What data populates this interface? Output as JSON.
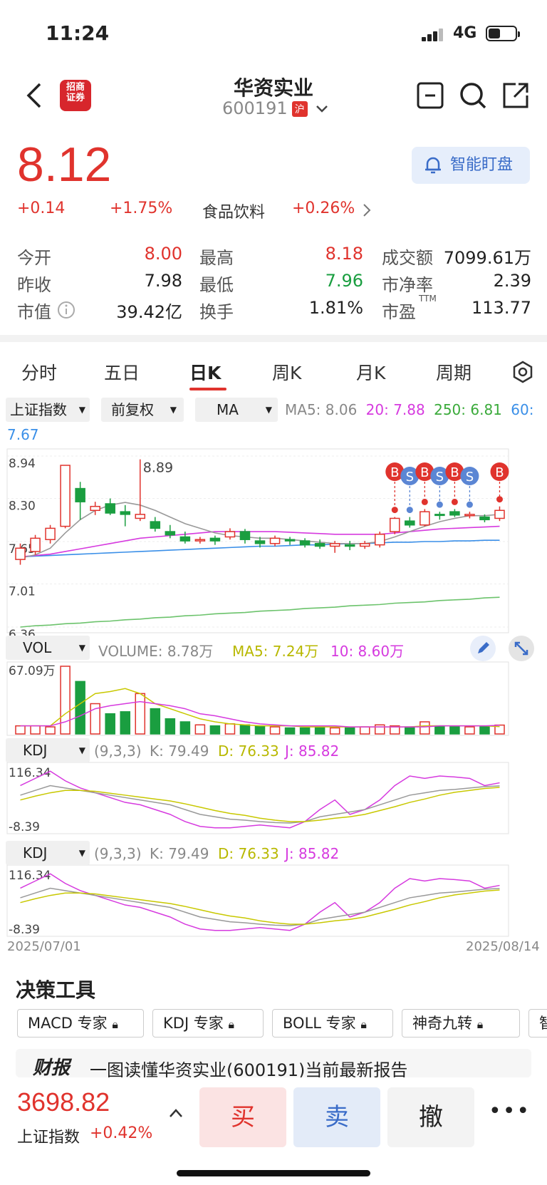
{
  "status_bar": {
    "time": "11:24",
    "network": "4G"
  },
  "header": {
    "back_icon": "chevron-left-icon",
    "broker_logo_text": "招商证券",
    "broker_logo_sub": "CMS",
    "stock_name": "华资实业",
    "stock_code": "600191",
    "market_badge": "沪",
    "icons": [
      "minus-square-icon",
      "search-icon",
      "share-icon"
    ]
  },
  "quote": {
    "price": "8.12",
    "change": "+0.14",
    "change_pct": "+1.75%",
    "sector_name": "食品饮料",
    "sector_change": "+0.26%",
    "alert_button": "智能盯盘",
    "price_color": "#e0332d"
  },
  "stats": {
    "row1": {
      "l1": "今开",
      "v1": "8.00",
      "l2": "最高",
      "v2": "8.18",
      "l3": "成交额",
      "v3": "7099.61万"
    },
    "row2": {
      "l1": "昨收",
      "v1": "7.98",
      "l2": "最低",
      "v2": "7.96",
      "l3": "市净率",
      "v3": "2.39"
    },
    "row3": {
      "l1": "市值",
      "v1": "39.42亿",
      "l2": "换手",
      "v2": "1.81%",
      "l3": "市盈",
      "l3_sup": "TTM",
      "v3": "113.77"
    }
  },
  "tabs": [
    "分时",
    "五日",
    "日K",
    "周K",
    "月K",
    "周期"
  ],
  "active_tab": "日K",
  "selectors": {
    "index": "上证指数",
    "adjust": "前复权",
    "indicator": "MA"
  },
  "ma_legend": {
    "ma5": "MA5: 8.06",
    "ma20": "20: 7.88",
    "ma250": "250: 6.81",
    "ma60": "60:",
    "ma60_val": "7.67"
  },
  "price_axis": [
    "8.94",
    "8.30",
    "7.65",
    "7.01",
    "6.36"
  ],
  "high_label": "8.89",
  "markers": [
    "B",
    "S",
    "B",
    "S",
    "B",
    "S",
    "B"
  ],
  "volume": {
    "selector": "VOL",
    "legend": "VOLUME: 8.78万",
    "ma5": "MA5: 7.24万",
    "ma10": "10: 8.60万",
    "axis_max": "67.09万"
  },
  "kdj1": {
    "selector": "KDJ",
    "params": "(9,3,3)",
    "k": "K: 79.49",
    "d": "D: 76.33",
    "j": "J: 85.82",
    "max": "116.34",
    "min": "-8.39"
  },
  "kdj2": {
    "selector": "KDJ",
    "params": "(9,3,3)",
    "k": "K: 79.49",
    "d": "D: 76.33",
    "j": "J: 85.82",
    "max": "116.34",
    "min": "-8.39"
  },
  "dates": {
    "start": "2025/07/01",
    "end": "2025/08/14"
  },
  "tools": {
    "title": "决策工具",
    "chips": [
      "MACD 专家",
      "KDJ 专家",
      "BOLL 专家",
      "神奇九转",
      "智"
    ],
    "report_tag": "财报",
    "report_text": "一图读懂华资实业(600191)当前最新报告"
  },
  "bottom": {
    "index_price": "3698.82",
    "index_name": "上证指数",
    "index_change": "+0.42%",
    "buy": "买",
    "sell": "卖",
    "cancel": "撤",
    "more": "•••"
  },
  "chart_data": {
    "type": "candlestick",
    "title": "",
    "x_start": "2025/07/01",
    "x_end": "2025/08/14",
    "ylim": [
      6.36,
      8.94
    ],
    "candles": [
      {
        "o": 7.38,
        "c": 7.55,
        "h": 7.62,
        "l": 7.3
      },
      {
        "o": 7.5,
        "c": 7.7,
        "h": 7.75,
        "l": 7.45
      },
      {
        "o": 7.68,
        "c": 7.85,
        "h": 7.9,
        "l": 7.62
      },
      {
        "o": 7.88,
        "c": 8.8,
        "h": 8.8,
        "l": 7.85
      },
      {
        "o": 8.45,
        "c": 8.25,
        "h": 8.55,
        "l": 7.98
      },
      {
        "o": 8.12,
        "c": 8.18,
        "h": 8.25,
        "l": 8.05
      },
      {
        "o": 8.22,
        "c": 8.08,
        "h": 8.3,
        "l": 8.05
      },
      {
        "o": 8.1,
        "c": 8.06,
        "h": 8.2,
        "l": 7.88
      },
      {
        "o": 8.0,
        "c": 8.06,
        "h": 8.89,
        "l": 7.96
      },
      {
        "o": 7.95,
        "c": 7.85,
        "h": 8.02,
        "l": 7.8
      },
      {
        "o": 7.8,
        "c": 7.75,
        "h": 7.9,
        "l": 7.7
      },
      {
        "o": 7.72,
        "c": 7.66,
        "h": 7.8,
        "l": 7.62
      },
      {
        "o": 7.66,
        "c": 7.68,
        "h": 7.72,
        "l": 7.62
      },
      {
        "o": 7.7,
        "c": 7.66,
        "h": 7.74,
        "l": 7.6
      },
      {
        "o": 7.72,
        "c": 7.8,
        "h": 7.85,
        "l": 7.68
      },
      {
        "o": 7.8,
        "c": 7.68,
        "h": 7.84,
        "l": 7.62
      },
      {
        "o": 7.66,
        "c": 7.62,
        "h": 7.72,
        "l": 7.56
      },
      {
        "o": 7.62,
        "c": 7.7,
        "h": 7.74,
        "l": 7.58
      },
      {
        "o": 7.68,
        "c": 7.66,
        "h": 7.72,
        "l": 7.6
      },
      {
        "o": 7.66,
        "c": 7.6,
        "h": 7.7,
        "l": 7.56
      },
      {
        "o": 7.62,
        "c": 7.58,
        "h": 7.68,
        "l": 7.54
      },
      {
        "o": 7.58,
        "c": 7.62,
        "h": 7.66,
        "l": 7.48
      },
      {
        "o": 7.6,
        "c": 7.58,
        "h": 7.66,
        "l": 7.52
      },
      {
        "o": 7.58,
        "c": 7.62,
        "h": 7.66,
        "l": 7.54
      },
      {
        "o": 7.6,
        "c": 7.76,
        "h": 7.8,
        "l": 7.56
      },
      {
        "o": 7.8,
        "c": 8.0,
        "h": 8.02,
        "l": 7.76
      },
      {
        "o": 7.96,
        "c": 7.9,
        "h": 8.02,
        "l": 7.86
      },
      {
        "o": 7.9,
        "c": 8.1,
        "h": 8.14,
        "l": 7.88
      },
      {
        "o": 8.06,
        "c": 8.05,
        "h": 8.1,
        "l": 7.98
      },
      {
        "o": 8.1,
        "c": 8.05,
        "h": 8.14,
        "l": 8.02
      },
      {
        "o": 8.04,
        "c": 8.06,
        "h": 8.1,
        "l": 8.0
      },
      {
        "o": 8.02,
        "c": 7.98,
        "h": 8.06,
        "l": 7.94
      },
      {
        "o": 8.0,
        "c": 8.12,
        "h": 8.18,
        "l": 7.96
      }
    ],
    "ma5": [
      7.4,
      7.45,
      7.55,
      7.78,
      7.98,
      8.12,
      8.2,
      8.24,
      8.2,
      8.12,
      8.02,
      7.92,
      7.85,
      7.78,
      7.74,
      7.72,
      7.7,
      7.7,
      7.68,
      7.66,
      7.64,
      7.62,
      7.62,
      7.62,
      7.65,
      7.72,
      7.8,
      7.88,
      7.95,
      8.0,
      8.04,
      8.04,
      8.06
    ],
    "ma20": [
      7.42,
      7.44,
      7.46,
      7.5,
      7.54,
      7.58,
      7.62,
      7.66,
      7.7,
      7.72,
      7.74,
      7.76,
      7.78,
      7.8,
      7.8,
      7.8,
      7.8,
      7.8,
      7.79,
      7.78,
      7.77,
      7.76,
      7.76,
      7.76,
      7.76,
      7.78,
      7.8,
      7.82,
      7.84,
      7.85,
      7.86,
      7.87,
      7.88
    ],
    "ma60": [
      7.42,
      7.43,
      7.44,
      7.45,
      7.46,
      7.47,
      7.48,
      7.49,
      7.5,
      7.51,
      7.52,
      7.53,
      7.54,
      7.55,
      7.56,
      7.57,
      7.58,
      7.58,
      7.59,
      7.6,
      7.6,
      7.61,
      7.62,
      7.62,
      7.63,
      7.64,
      7.64,
      7.65,
      7.65,
      7.66,
      7.66,
      7.67,
      7.67
    ],
    "ma250": [
      6.36,
      6.38,
      6.39,
      6.41,
      6.42,
      6.44,
      6.45,
      6.47,
      6.48,
      6.5,
      6.51,
      6.53,
      6.54,
      6.56,
      6.57,
      6.58,
      6.6,
      6.61,
      6.62,
      6.64,
      6.65,
      6.66,
      6.68,
      6.69,
      6.7,
      6.72,
      6.73,
      6.74,
      6.76,
      6.77,
      6.78,
      6.8,
      6.81
    ],
    "volume": [
      8,
      8,
      7,
      67.09,
      52,
      30,
      20,
      22,
      40,
      25,
      15,
      12,
      9,
      8,
      10,
      9,
      8,
      7,
      6,
      6,
      7,
      6,
      6,
      7,
      9,
      8,
      7,
      12,
      8,
      7,
      7,
      7,
      8.78
    ],
    "volume_ma5": [
      8,
      8,
      8,
      20,
      30,
      40,
      42,
      45,
      40,
      30,
      25,
      20,
      15,
      12,
      10,
      9,
      8,
      8,
      8,
      7,
      7,
      7,
      7,
      7,
      7,
      7,
      7,
      8,
      8,
      8,
      8,
      8,
      7.24
    ],
    "volume_ma10": [
      8,
      8,
      8,
      12,
      18,
      25,
      28,
      30,
      32,
      30,
      28,
      25,
      20,
      18,
      15,
      12,
      10,
      9,
      8,
      8,
      8,
      8,
      7,
      7,
      7,
      7,
      7,
      7,
      8,
      8,
      8,
      8,
      8.6
    ],
    "kdj_k": [
      60,
      70,
      80,
      75,
      70,
      65,
      60,
      55,
      50,
      45,
      40,
      30,
      20,
      15,
      10,
      8,
      5,
      3,
      2,
      5,
      15,
      20,
      25,
      30,
      40,
      50,
      60,
      65,
      70,
      72,
      75,
      78,
      79.49
    ],
    "kdj_d": [
      50,
      58,
      65,
      70,
      70,
      68,
      64,
      60,
      56,
      52,
      48,
      42,
      35,
      28,
      22,
      18,
      12,
      8,
      5,
      5,
      8,
      12,
      15,
      20,
      28,
      36,
      45,
      52,
      60,
      66,
      70,
      74,
      76.33
    ],
    "kdj_j": [
      80,
      95,
      110,
      90,
      75,
      65,
      55,
      45,
      40,
      30,
      20,
      5,
      -5,
      -8,
      -8,
      -5,
      -2,
      -5,
      -8,
      5,
      30,
      50,
      20,
      30,
      50,
      80,
      100,
      95,
      100,
      98,
      95,
      80,
      85.82
    ],
    "markers": [
      {
        "index": 25,
        "type": "B"
      },
      {
        "index": 26,
        "type": "S"
      },
      {
        "index": 27,
        "type": "B"
      },
      {
        "index": 28,
        "type": "S"
      },
      {
        "index": 29,
        "type": "B"
      },
      {
        "index": 30,
        "type": "S"
      },
      {
        "index": 32,
        "type": "B"
      }
    ]
  }
}
